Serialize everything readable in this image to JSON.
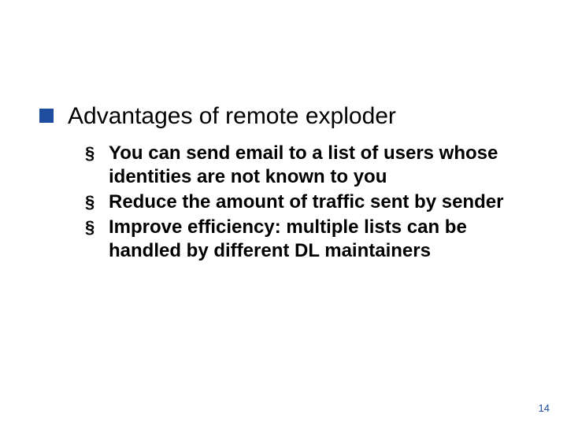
{
  "slide": {
    "heading": "Advantages of remote exploder",
    "bullets": [
      "You can send email to a list of users whose identities are not known to you",
      "Reduce the amount of traffic sent by sender",
      "Improve efficiency: multiple lists can be handled by different DL maintainers"
    ],
    "page_number": "14"
  }
}
